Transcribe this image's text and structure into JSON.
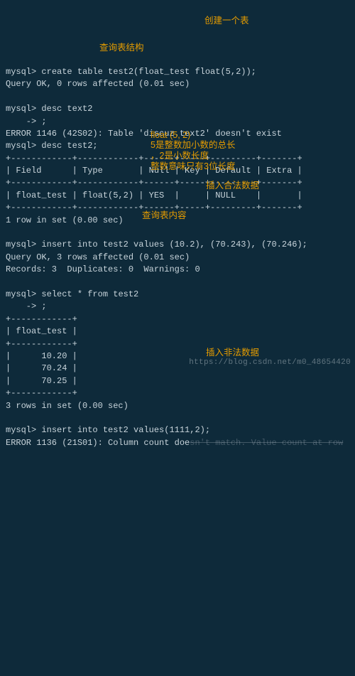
{
  "prompt": "mysql>",
  "cont": "    ->",
  "stmt": {
    "create": "create table test2(float_test float(5,2));",
    "create_ok": "Query OK, 0 rows affected (0.01 sec)",
    "desc_wrong": "desc text2",
    "semi": ";",
    "err_1146": "ERROR 1146 (42S02): Table 'discuz.text2' doesn't exist",
    "desc_right": "desc test2;",
    "insert1": "insert into test2 values (10.2), (70.243), (70.246);",
    "insert1_ok": "Query OK, 3 rows affected (0.01 sec)",
    "insert1_info": "Records: 3  Duplicates: 0  Warnings: 0",
    "select": "select * from test2",
    "rows1": "1 row in set (0.00 sec)",
    "rows3": "3 rows in set (0.00 sec)",
    "insert2": "insert into test2 values(1111,2);",
    "err_1136": "ERROR 1136 (21S01): Column count doe"
  },
  "desc_table": {
    "sep": "+------------+------------+------+-----+---------+-------+",
    "hdr": "| Field      | Type       | Null | Key | Default | Extra |",
    "row": "| float_test | float(5,2) | YES  |     | NULL    |       |"
  },
  "result_table": {
    "sep": "+------------+",
    "hdr": "| float_test |",
    "r1": "|      10.20 |",
    "r2": "|      70.24 |",
    "r3": "|      70.25 |"
  },
  "ann": {
    "create": "创建一个表",
    "desc": "查询表结构",
    "float_spec": "float (5, 2)",
    "float_l1": "5是整数加小数的总长",
    "float_l2": "，2是小数长度",
    "float_l3": "整数意味只有3位长度",
    "insert_ok": "插入合法数据",
    "select": "查询表内容",
    "insert_bad": "插入非法数据"
  },
  "watermark": "https://blog.csdn.net/m0_48654420",
  "strike": "sn't match. Value count at row"
}
